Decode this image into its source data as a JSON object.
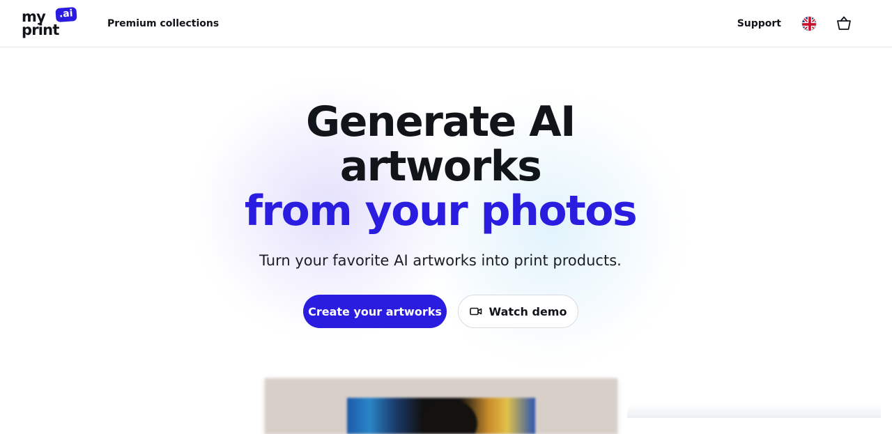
{
  "header": {
    "logo": {
      "word_top": "my",
      "word_bottom": "print",
      "badge": ".ai"
    },
    "nav": {
      "premium_collections": "Premium collections",
      "support": "Support"
    },
    "icons": {
      "language": "uk-flag-icon",
      "cart": "basket-icon"
    }
  },
  "hero": {
    "title_line1": "Generate AI",
    "title_line2": "artworks",
    "title_line3": "from your photos",
    "subtitle": "Turn your favorite AI artworks into print products.",
    "primary_button": "Create your artworks",
    "secondary_button": "Watch demo",
    "secondary_button_icon": "video-camera-icon"
  },
  "colors": {
    "accent": "#2b1de0",
    "text": "#111418",
    "border": "#e6e7eb"
  }
}
